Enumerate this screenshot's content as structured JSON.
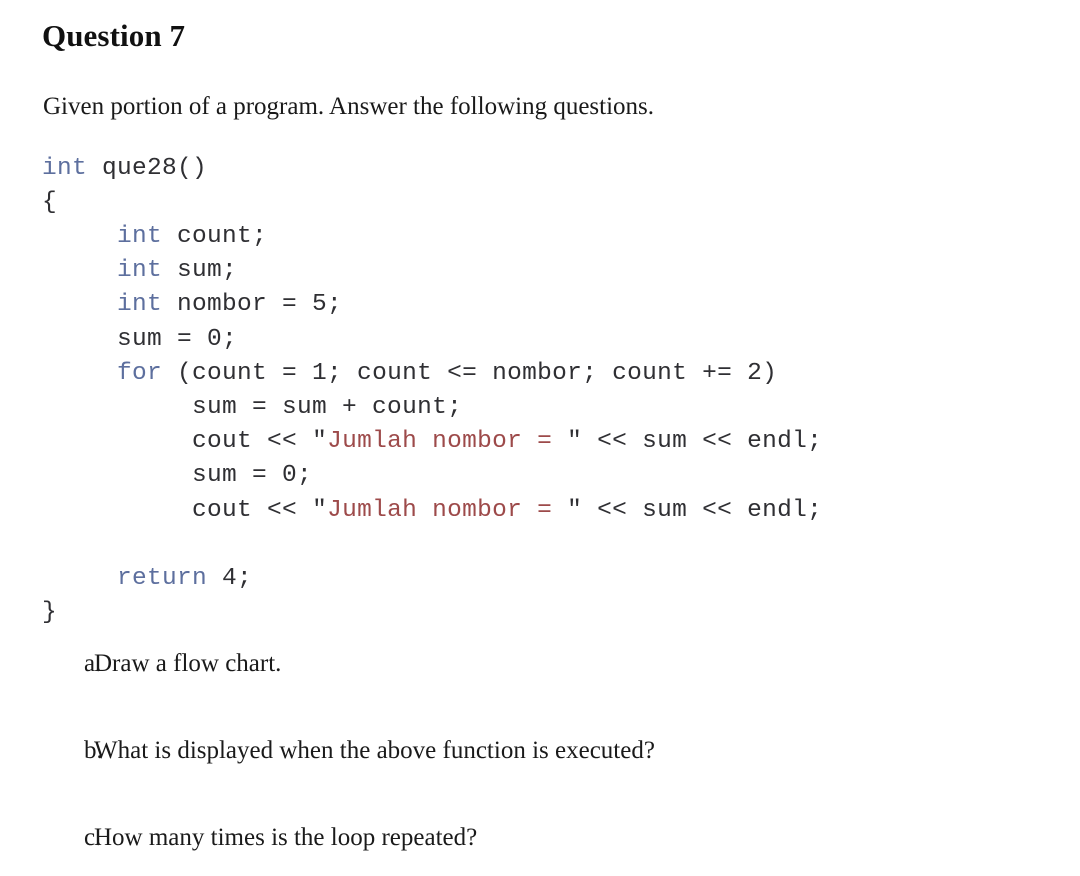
{
  "document": {
    "title": "Question 7",
    "intro": "Given portion of a program. Answer the following questions."
  },
  "code": {
    "language": "C++",
    "keyword_color": "#5d6f9e",
    "string_color": "#9d4a4a",
    "text_color": "#2f2f33",
    "lines": [
      {
        "indent": 0,
        "keyword": "int",
        "rest": " que28()"
      },
      {
        "indent": 0,
        "keyword": "",
        "rest": "{"
      },
      {
        "indent": 1,
        "keyword": "int",
        "rest": " count;"
      },
      {
        "indent": 1,
        "keyword": "int",
        "rest": " sum;"
      },
      {
        "indent": 1,
        "keyword": "int",
        "rest": " nombor = 5;"
      },
      {
        "indent": 1,
        "keyword": "",
        "rest": "sum = 0;"
      },
      {
        "indent": 1,
        "keyword": "for",
        "rest": " (count = 1; count <= nombor; count += 2)"
      },
      {
        "indent": 2,
        "keyword": "",
        "rest": "sum = sum + count;"
      },
      {
        "indent": 2,
        "keyword": "",
        "rest": "cout << ",
        "string": "\"Jumlah nombor = \"",
        "tail": " << sum << endl;"
      },
      {
        "indent": 2,
        "keyword": "",
        "rest": "sum = 0;"
      },
      {
        "indent": 2,
        "keyword": "",
        "rest": "cout << ",
        "string": "\"Jumlah nombor = \"",
        "tail": " << sum << endl;"
      },
      {
        "indent": 0,
        "keyword": "",
        "rest": ""
      },
      {
        "indent": 1,
        "keyword": "return",
        "rest": " 4;"
      },
      {
        "indent": 0,
        "keyword": "",
        "rest": "}"
      }
    ],
    "full_text": "int que28()\n{\n     int count;\n     int sum;\n     int nombor = 5;\n     sum = 0;\n     for (count = 1; count <= nombor; count += 2)\n          sum = sum + count;\n          cout << \"Jumlah nombor = \" << sum << endl;\n          sum = 0;\n          cout << \"Jumlah nombor = \" << sum << endl;\n\n     return 4;\n}"
  },
  "questions": [
    {
      "letter": "a.",
      "text": "Draw a flow chart."
    },
    {
      "letter": "b.",
      "text": "What is displayed when the above function is executed?"
    },
    {
      "letter": "c.",
      "text": "How many times is the loop repeated?"
    }
  ]
}
